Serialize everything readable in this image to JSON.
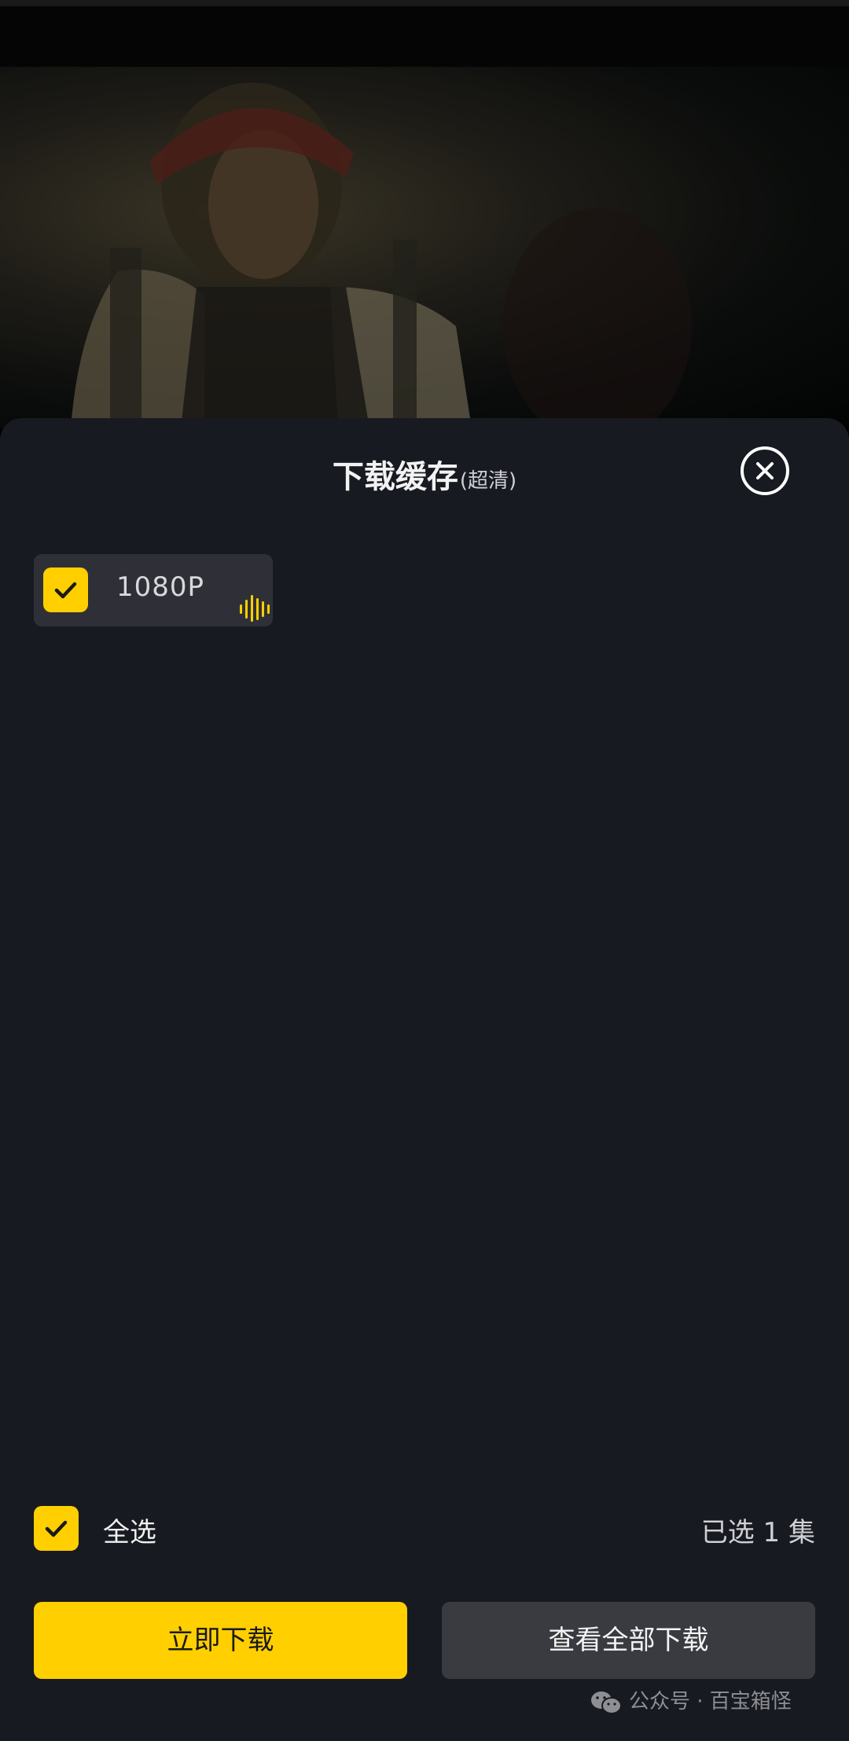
{
  "sheet": {
    "title": "下载缓存",
    "subtitle": "(超清)",
    "close_icon": "close-circle-icon"
  },
  "qualities": [
    {
      "label": "1080P",
      "selected": true,
      "badge_icon": "audio-wave-icon"
    }
  ],
  "footer": {
    "select_all_label": "全选",
    "selected_count": "已选 1 集",
    "download_button": "立即下载",
    "view_all_button": "查看全部下载"
  },
  "watermark": {
    "text": "公众号 · 百宝箱怪",
    "icon": "wechat-icon"
  },
  "colors": {
    "accent": "#ffcf00",
    "sheet_bg": "#181a21",
    "chip_bg": "#2f3037",
    "secondary_button": "#3a3b41"
  }
}
